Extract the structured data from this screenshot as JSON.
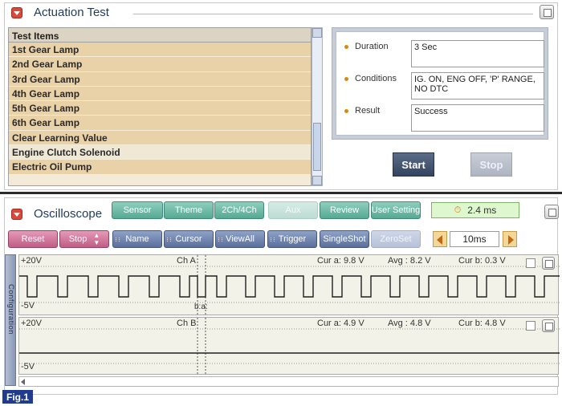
{
  "actuation": {
    "title": "Actuation Test",
    "list_header": "Test Items",
    "items": [
      {
        "label": "1st Gear Lamp",
        "selected": false
      },
      {
        "label": "2nd Gear Lamp",
        "selected": false
      },
      {
        "label": "3rd Gear Lamp",
        "selected": false
      },
      {
        "label": "4th Gear Lamp",
        "selected": false
      },
      {
        "label": "5th Gear Lamp",
        "selected": false
      },
      {
        "label": "6th Gear Lamp",
        "selected": false
      },
      {
        "label": "Clear Learning Value",
        "selected": false
      },
      {
        "label": "Engine Clutch Solenoid",
        "selected": true
      },
      {
        "label": "Electric Oil Pump",
        "selected": false
      }
    ],
    "details": {
      "duration_label": "Duration",
      "duration_value": "3 Sec",
      "conditions_label": "Conditions",
      "conditions_value": "IG. ON, ENG OFF, 'P' RANGE, NO DTC",
      "result_label": "Result",
      "result_value": "Success"
    },
    "start_label": "Start",
    "stop_label": "Stop"
  },
  "oscilloscope": {
    "title": "Oscilloscope",
    "toolbar1": {
      "sensor": "Sensor",
      "theme": "Theme",
      "channels": "2Ch/4Ch",
      "aux": "Aux",
      "review": "Review",
      "user_setting": "User Setting"
    },
    "time_readout": "2.4 ms",
    "toolbar2": {
      "reset": "Reset",
      "stop": "Stop",
      "name": "Name",
      "cursor": "Cursor",
      "viewall": "ViewAll",
      "trigger": "Trigger",
      "singleshot": "SingleShot",
      "zeroset": "ZeroSet"
    },
    "timebase": "10ms",
    "side_tab": "Configuration",
    "channel_a": {
      "top": "+20V",
      "bottom": "-5V",
      "name": "Ch A",
      "cur_a": "Cur a: 9.8 V",
      "avg": "Avg : 8.2 V",
      "cur_b": "Cur b: 0.3 V",
      "cursor_label": "b:a:"
    },
    "channel_b": {
      "top": "+20V",
      "bottom": "-5V",
      "name": "Ch B",
      "cur_a": "Cur a: 4.9 V",
      "avg": "Avg : 4.8 V",
      "cur_b": "Cur b: 4.8 V"
    }
  },
  "figure_label": "Fig.1",
  "colors": {
    "list_item": "#e9d1a8",
    "teal_button": "#55a994",
    "pink_button": "#c05d85",
    "blue_button": "#5a6f9c",
    "start_button": "#34445f",
    "figure_label": "#213c8f"
  }
}
